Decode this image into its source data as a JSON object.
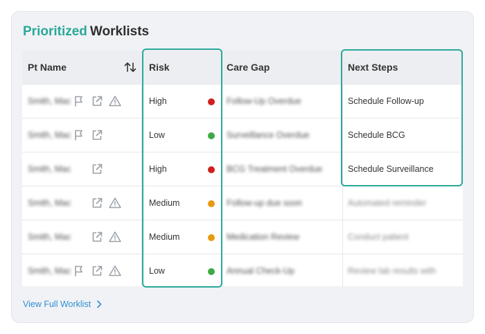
{
  "title": {
    "accent": "Prioritized",
    "rest": "Worklists"
  },
  "colors": {
    "accent": "#2aa89a",
    "high": "#d11f1f",
    "low": "#3daa45",
    "medium": "#e89a12",
    "link": "#2d8fd5"
  },
  "columns": {
    "pt_name": "Pt Name",
    "risk": "Risk",
    "care_gap": "Care Gap",
    "next_steps": "Next Steps"
  },
  "rows": [
    {
      "name": "Smith, Mac",
      "risk": "High",
      "risk_level": "high",
      "care_gap": "Follow-Up Overdue",
      "next_step": "Schedule Follow-up",
      "flag": true,
      "warning": true
    },
    {
      "name": "Smith, Mac",
      "risk": "Low",
      "risk_level": "low",
      "care_gap": "Surveillance Overdue",
      "next_step": "Schedule BCG",
      "flag": true,
      "warning": false
    },
    {
      "name": "Smith, Mac",
      "risk": "High",
      "risk_level": "high",
      "care_gap": "BCG Treatment Overdue",
      "next_step": "Schedule Surveillance",
      "flag": false,
      "warning": false
    },
    {
      "name": "Smith, Mac",
      "risk": "Medium",
      "risk_level": "medium",
      "care_gap": "Follow-up due soon",
      "next_step": "Automated reminder",
      "flag": false,
      "warning": true
    },
    {
      "name": "Smith, Mac",
      "risk": "Medium",
      "risk_level": "medium",
      "care_gap": "Medication Review",
      "next_step": "Conduct patient",
      "flag": false,
      "warning": true
    },
    {
      "name": "Smith, Mac",
      "risk": "Low",
      "risk_level": "low",
      "care_gap": "Annual Check-Up",
      "next_step": "Review lab results with",
      "flag": true,
      "warning": true
    }
  ],
  "footer": {
    "link_label": "View Full Worklist"
  }
}
